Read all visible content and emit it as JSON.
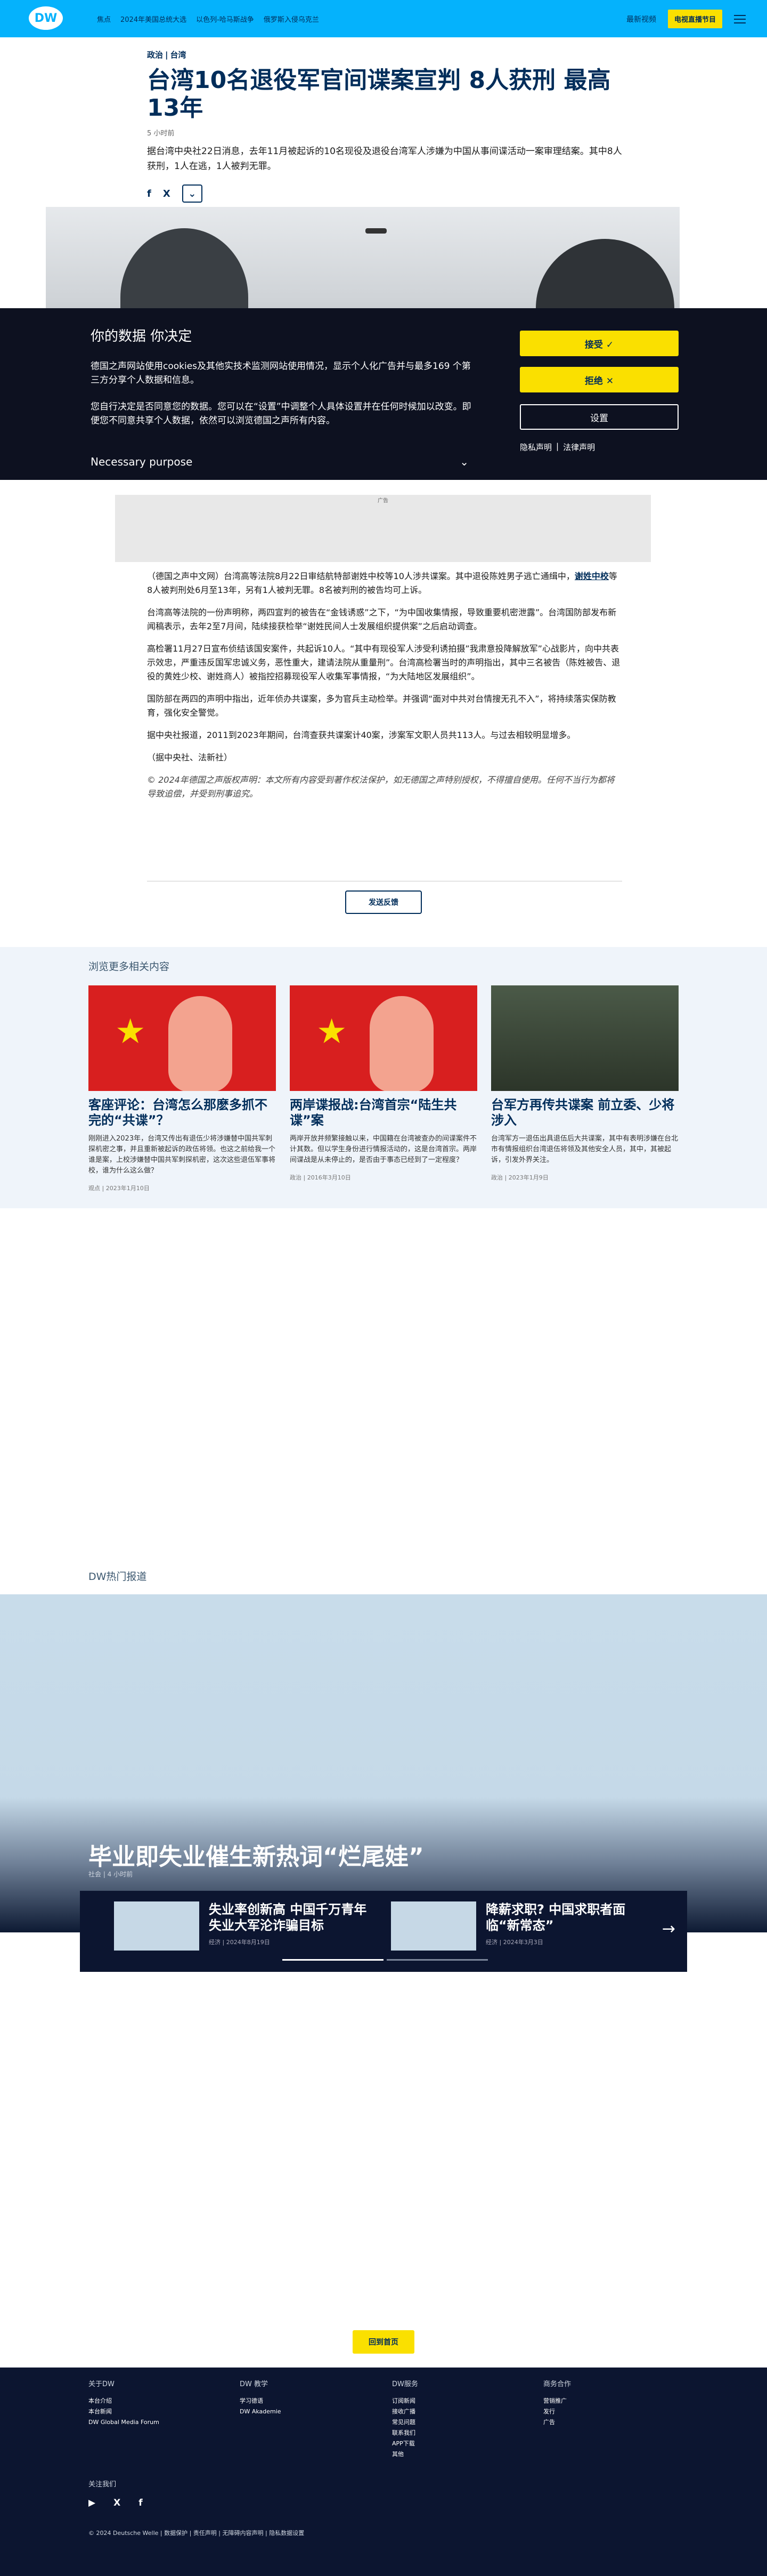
{
  "header": {
    "logo": "DW",
    "nav": [
      "焦点",
      "2024年美国总统大选",
      "以色列-哈马斯战争",
      "俄罗斯入侵乌克兰"
    ],
    "headlines_label": "最新视频",
    "live_label": "电视直播节目"
  },
  "article": {
    "kicker_section": "政治",
    "kicker_region": "台湾",
    "title": "台湾10名退役军官间谍案宣判 8人获刑 最高13年",
    "time": "5 小时前",
    "lead": "据台湾中央社22日消息，去年11月被起诉的10名现役及退役台湾军人涉嫌为中国从事间谍活动一案审理结案。其中8人获刑，1人在逃，1人被判无罪。",
    "share": [
      "f",
      "X",
      "⌄"
    ]
  },
  "cookie": {
    "title": "你的数据 你决定",
    "p1": "德国之声网站使用cookies及其他实技术监测网站使用情况，显示个人化广告并与最多169 个第三方分享个人数据和信息。",
    "p2": "您自行决定是否同意您的数据。您可以在“设置”中调整个人具体设置并在任何时候加以改变。即便您不同意共享个人数据，依然可以浏览德国之声所有内容。",
    "purpose": "Necessary purpose",
    "accept": "接受 ✓",
    "reject": "拒绝 ✕",
    "settings": "设置",
    "privacy": "隐私声明",
    "legal": "法律声明"
  },
  "ad_label": "广告",
  "body": {
    "p1": "（德国之声中文网）台湾高等法院8月22日审结航特部谢姓中校等10人涉共谍案。其中退役陈姓男子逃亡通缉中，",
    "p1_link": "谢姓中校",
    "p1_rest": "等8人被判刑处6月至13年，另有1人被判无罪。8名被判刑的被告均可上诉。",
    "p2": "台湾高等法院的一份声明称，两四宣判的被告在“金钱诱惑”之下，“为中国收集情报，导致重要机密泄露”。台湾国防部发布新闻稿表示，去年2至7月间，陆续接获检举“谢姓民间人士发展组织提供案”之后启动调查。",
    "p3": "高检署11月27日宣布侦结该国安案件，共起诉10人。“其中有现役军人涉受利诱拍摄”我肃意投降解放军”心战影片，向中共表示效忠，严重违反国军忠诚义务，恶性重大，建请法院从重量刑”。台湾高检署当时的声明指出，其中三名被告（陈姓被告、退役的黄姓少校、谢姓商人）被指控招募现役军人收集军事情报，“为大陆地区发展组织”。",
    "p4": "国防部在两四的声明中指出，近年侦办共谍案，多为官兵主动检举。并强调“面对中共对台情搜无孔不入”，将持续落实保防教育，强化安全警觉。",
    "p5": "据中央社报道，2011到2023年期间，台湾查获共谍案计40案，涉案军文职人员共113人。与过去相较明显增多。",
    "p6": "（据中央社、法新社）",
    "copyright": "© 2024年德国之声版权声明：本文所有内容受到著作权法保护，如无德国之声特别授权，不得擅自使用。任何不当行为都将导致追偿，并受到刑事追究。"
  },
  "feedback_label": "发送反馈",
  "related": {
    "heading": "浏览更多相关内容",
    "cards": [
      {
        "title": "客座评论：台湾怎么那麽多抓不完的“共谍”？",
        "desc": "刚刚进入2023年，台湾又传出有退伍少将涉嫌替中国共军刺探机密之事，并且重新被起诉的政伍将领。也这之前给我一个谁是案，上校涉嫌替中国共军刺探机密，这次这些退伍军事将校，谁为什么这么做？",
        "meta": "观点 | 2023年1月10日"
      },
      {
        "title": "两岸谍报战:台湾首宗“陆生共谍”案",
        "desc": "两岸开放并频繁接触以来，中国籍在台湾被查办的间谍案件不计其数。但以学生身份进行情报活动的，这是台湾首宗。两岸间谍战是从未停止的，是否由于事态已经到了一定程度？",
        "meta": "政治 | 2016年3月10日"
      },
      {
        "title": "台军方再传共谍案 前立委、少将涉入",
        "desc": "台湾军方一退伍出具退伍后大共谍案，其中有表明涉嫌在台北市有情报组织台湾退伍将领及其他安全人员，其中，其被起诉，引发外界关注。",
        "meta": "政治 | 2023年1月9日"
      }
    ]
  },
  "hot": {
    "label": "DW热门报道",
    "title": "毕业即失业催生新热词“烂尾娃”",
    "meta": "社会 | 4 小时前",
    "slides": [
      {
        "title": "失业率创新高 中国千万青年失业大军沦诈骗目标",
        "meta": "经济 | 2024年8月19日"
      },
      {
        "title": "降薪求职? 中国求职者面临“新常态”",
        "meta": "经济 | 2024年3月3日"
      }
    ]
  },
  "back_to_top": "回到首页",
  "footer": {
    "cols": [
      {
        "title": "关于DW",
        "items": [
          "本台介绍",
          "本台新闻",
          "DW Global Media Forum"
        ]
      },
      {
        "title": "DW 教学",
        "items": [
          "学习德语",
          "DW Akademie"
        ]
      },
      {
        "title": "DW服务",
        "items": [
          "订阅新闻",
          "接收广播",
          "常见问题",
          "联系我们",
          "APP下载",
          "其他"
        ]
      },
      {
        "title": "商务合作",
        "items": [
          "营销推广",
          "发行",
          "广告"
        ]
      }
    ],
    "follow": "关注我们",
    "social": [
      "▶",
      "X",
      "f"
    ],
    "copyright": "© 2024 Deutsche Welle | 数据保护 | 责任声明 | 无障碍内容声明 | 隐私数据设置"
  }
}
